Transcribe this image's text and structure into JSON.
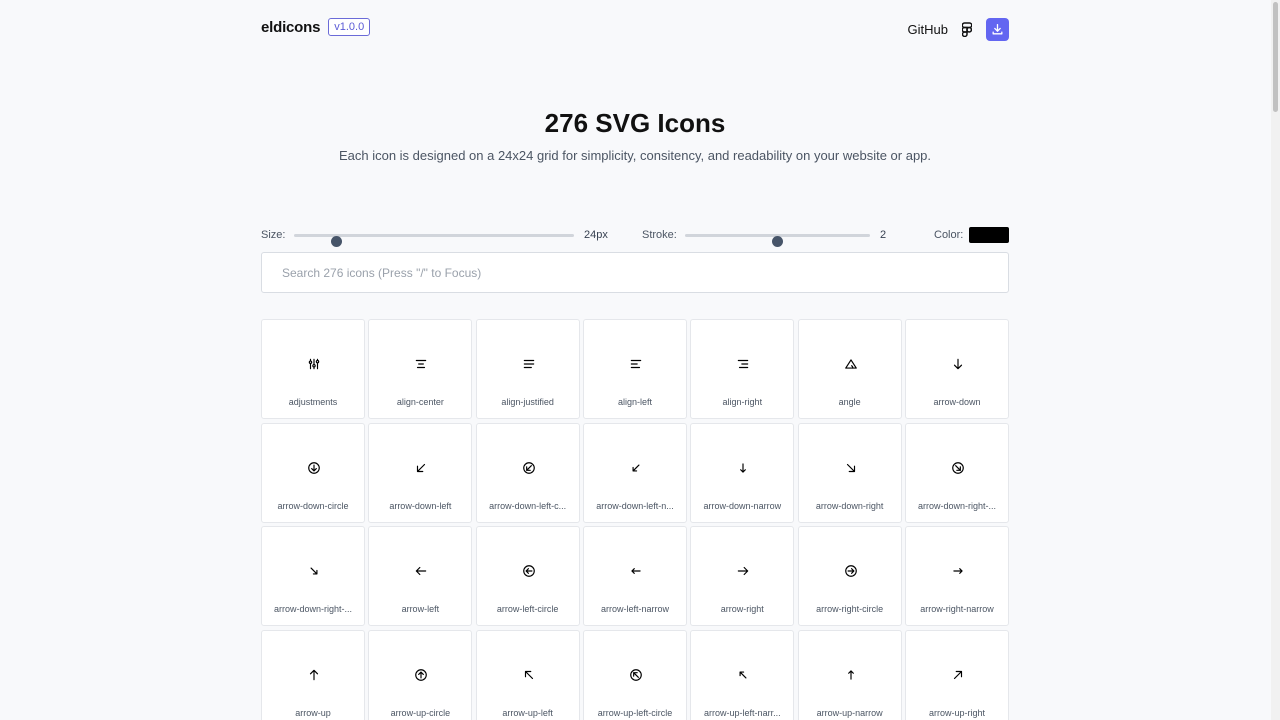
{
  "header": {
    "logo": "eldicons",
    "version": "v1.0.0",
    "github_label": "GitHub"
  },
  "hero": {
    "title": "276 SVG Icons",
    "subtitle": "Each icon is designed on a 24x24 grid for simplicity, consitency, and readability on your website or app."
  },
  "controls": {
    "size_label": "Size:",
    "size_value": "24px",
    "size_level": 0.15,
    "stroke_label": "Stroke:",
    "stroke_value": "2",
    "stroke_level": 0.5,
    "color_label": "Color:",
    "color": "#000000"
  },
  "search": {
    "placeholder": "Search 276 icons (Press \"/\" to Focus)"
  },
  "accent_color": "#6366f1",
  "icons": [
    {
      "label": "adjustments",
      "icon": "adjustments-icon"
    },
    {
      "label": "align-center",
      "icon": "align-center-icon"
    },
    {
      "label": "align-justified",
      "icon": "align-justified-icon"
    },
    {
      "label": "align-left",
      "icon": "align-left-icon"
    },
    {
      "label": "align-right",
      "icon": "align-right-icon"
    },
    {
      "label": "angle",
      "icon": "angle-icon"
    },
    {
      "label": "arrow-down",
      "icon": "arrow-down-icon"
    },
    {
      "label": "arrow-down-circle",
      "icon": "arrow-down-circle-icon"
    },
    {
      "label": "arrow-down-left",
      "icon": "arrow-down-left-icon"
    },
    {
      "label": "arrow-down-left-c...",
      "icon": "arrow-down-left-circle-icon"
    },
    {
      "label": "arrow-down-left-n...",
      "icon": "arrow-down-left-narrow-icon"
    },
    {
      "label": "arrow-down-narrow",
      "icon": "arrow-down-narrow-icon"
    },
    {
      "label": "arrow-down-right",
      "icon": "arrow-down-right-icon"
    },
    {
      "label": "arrow-down-right-...",
      "icon": "arrow-down-right-circle-icon"
    },
    {
      "label": "arrow-down-right-...",
      "icon": "arrow-down-right-narrow-icon"
    },
    {
      "label": "arrow-left",
      "icon": "arrow-left-icon"
    },
    {
      "label": "arrow-left-circle",
      "icon": "arrow-left-circle-icon"
    },
    {
      "label": "arrow-left-narrow",
      "icon": "arrow-left-narrow-icon"
    },
    {
      "label": "arrow-right",
      "icon": "arrow-right-icon"
    },
    {
      "label": "arrow-right-circle",
      "icon": "arrow-right-circle-icon"
    },
    {
      "label": "arrow-right-narrow",
      "icon": "arrow-right-narrow-icon"
    },
    {
      "label": "arrow-up",
      "icon": "arrow-up-icon"
    },
    {
      "label": "arrow-up-circle",
      "icon": "arrow-up-circle-icon"
    },
    {
      "label": "arrow-up-left",
      "icon": "arrow-up-left-icon"
    },
    {
      "label": "arrow-up-left-circle",
      "icon": "arrow-up-left-circle-icon"
    },
    {
      "label": "arrow-up-left-narr...",
      "icon": "arrow-up-left-narrow-icon"
    },
    {
      "label": "arrow-up-narrow",
      "icon": "arrow-up-narrow-icon"
    },
    {
      "label": "arrow-up-right",
      "icon": "arrow-up-right-icon"
    }
  ]
}
